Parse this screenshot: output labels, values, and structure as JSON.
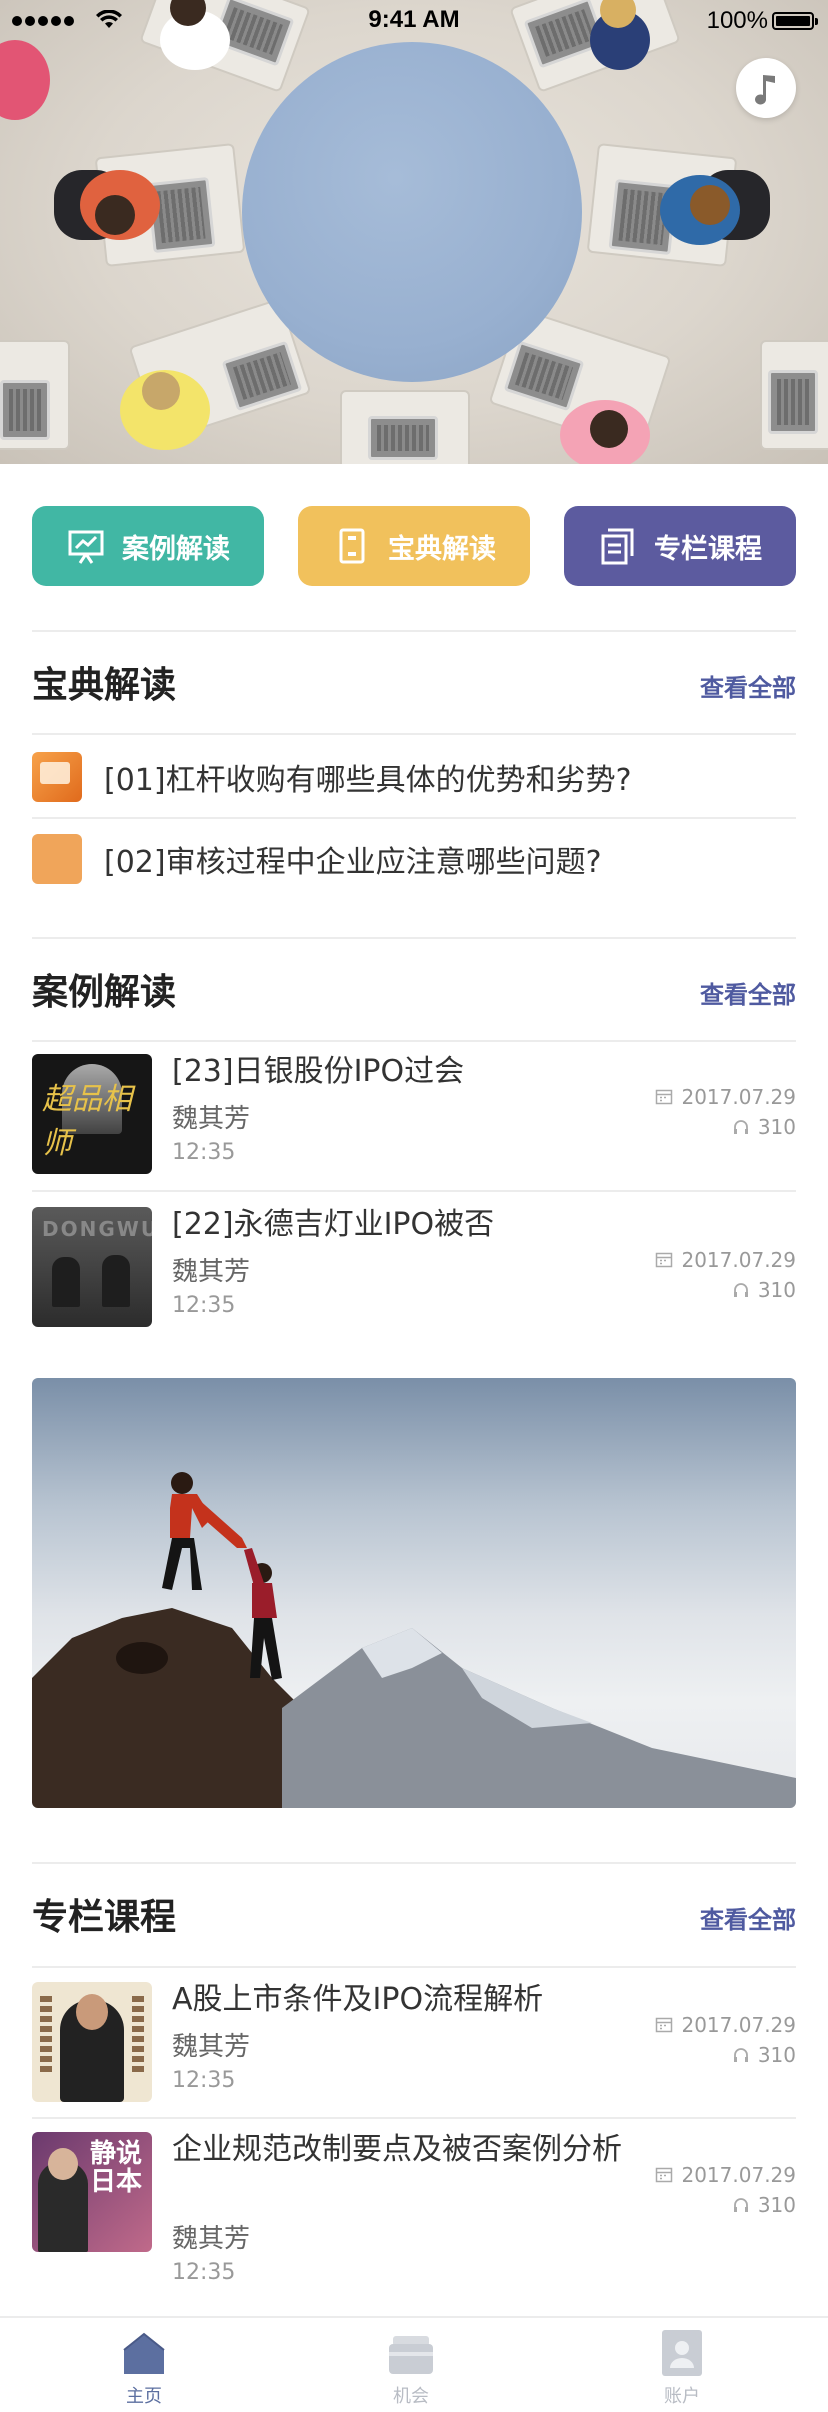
{
  "status_bar": {
    "time": "9:41 AM",
    "battery": "100%"
  },
  "quick_nav": [
    {
      "label": "案例解读",
      "icon": "presentation-chart-icon",
      "color": "#41b7a4"
    },
    {
      "label": "宝典解读",
      "icon": "book-page-icon",
      "color": "#f1c15c"
    },
    {
      "label": "专栏课程",
      "icon": "document-stack-icon",
      "color": "#5c5b9f"
    }
  ],
  "baodian": {
    "title": "宝典解读",
    "see_all": "查看全部",
    "items": [
      {
        "text": "[01]杠杆收购有哪些具体的优势和劣势?"
      },
      {
        "text": "[02]审核过程中企业应注意哪些问题?"
      }
    ]
  },
  "anli": {
    "title": "案例解读",
    "see_all": "查看全部",
    "items": [
      {
        "title": "[23]日银股份IPO过会",
        "author": "魏其芳",
        "duration": "12:35",
        "date": "2017.07.29",
        "listens": "310",
        "thumb_text": "超品相师"
      },
      {
        "title": "[22]永德吉灯业IPO被否",
        "author": "魏其芳",
        "duration": "12:35",
        "date": "2017.07.29",
        "listens": "310",
        "thumb_text": "DONGWU"
      }
    ]
  },
  "zhuanlan": {
    "title": "专栏课程",
    "see_all": "查看全部",
    "items": [
      {
        "title": "A股上市条件及IPO流程解析",
        "author": "魏其芳",
        "duration": "12:35",
        "date": "2017.07.29",
        "listens": "310"
      },
      {
        "title": "企业规范改制要点及被否案例分析",
        "author": "魏其芳",
        "duration": "12:35",
        "date": "2017.07.29",
        "listens": "310",
        "thumb_text": "静说日本"
      }
    ]
  },
  "tabbar": [
    {
      "label": "主页",
      "icon": "home-icon",
      "active": true
    },
    {
      "label": "机会",
      "icon": "wallet-icon",
      "active": false
    },
    {
      "label": "账户",
      "icon": "account-icon",
      "active": false
    }
  ],
  "colors": {
    "accent": "#4f5aa0",
    "teal": "#41b7a4",
    "yellow": "#f1c15c",
    "purple": "#5c5b9f"
  }
}
